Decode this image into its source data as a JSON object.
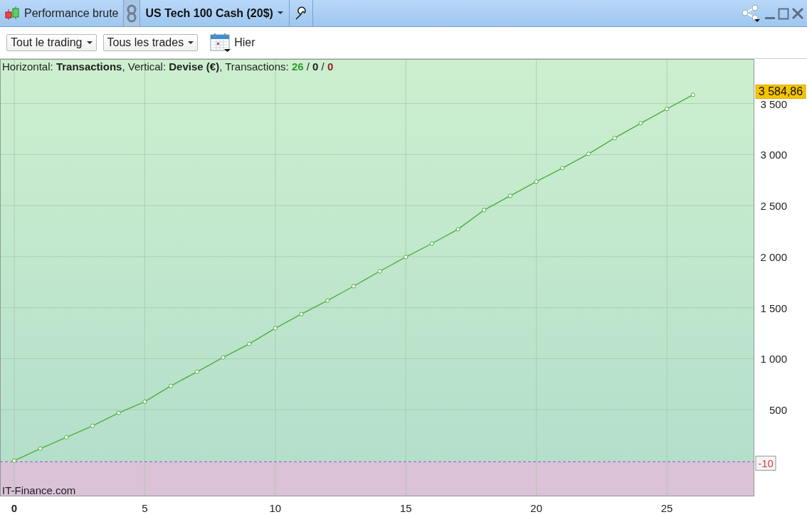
{
  "window": {
    "title": "Performance brute",
    "instrument": "US Tech 100 Cash (20$)"
  },
  "toolbar": {
    "dropdowns": [
      {
        "label": "Tout le trading"
      },
      {
        "label": "Tous les trades"
      }
    ],
    "date_label": "Hier"
  },
  "info_line": [
    {
      "text": "Horizontal: ",
      "kind": "plain"
    },
    {
      "text": "Transactions",
      "kind": "bold"
    },
    {
      "text": ", Vertical: ",
      "kind": "plain"
    },
    {
      "text": "Devise (€)",
      "kind": "bold"
    },
    {
      "text": ", Transactions: ",
      "kind": "plain"
    },
    {
      "text": "26",
      "kind": "bold",
      "color": "#2e9a2e"
    },
    {
      "text": " / ",
      "kind": "plain"
    },
    {
      "text": "0",
      "kind": "bold",
      "color": "#222222"
    },
    {
      "text": " / ",
      "kind": "plain"
    },
    {
      "text": "0",
      "kind": "bold",
      "color": "#a01c1c"
    }
  ],
  "chart": {
    "credit": "IT-Finance.com",
    "chart_data": {
      "type": "line",
      "x": [
        0,
        1,
        2,
        3,
        4,
        5,
        6,
        7,
        8,
        9,
        10,
        11,
        12,
        13,
        14,
        15,
        16,
        17,
        18,
        19,
        20,
        21,
        22,
        23,
        24,
        25,
        26
      ],
      "series": [
        {
          "color": "#4caf3c",
          "marker": "o",
          "values": [
            0,
            119,
            230,
            342,
            468,
            579,
            733,
            872,
            1012,
            1145,
            1298,
            1437,
            1570,
            1710,
            1856,
            1996,
            2128,
            2268,
            2456,
            2596,
            2735,
            2868,
            3007,
            3161,
            3307,
            3447,
            3585
          ]
        }
      ],
      "grid": true,
      "ref_lines": [
        {
          "axis": "y",
          "value": -10,
          "label": "-10",
          "color": "#9a6fc8"
        }
      ],
      "xlim": [
        -0.545,
        28.35
      ],
      "ylim": [
        -349,
        3936
      ],
      "xticks": [
        0,
        5,
        10,
        15,
        20,
        25
      ],
      "yticks": [
        {
          "value": 500,
          "label": "500"
        },
        {
          "value": 1000,
          "label": "1 000"
        },
        {
          "value": 1500,
          "label": "1 500"
        },
        {
          "value": 2000,
          "label": "2 000"
        },
        {
          "value": 2500,
          "label": "2 500"
        },
        {
          "value": 3000,
          "label": "3 000"
        },
        {
          "value": 3500,
          "label": "3 500"
        }
      ],
      "annotations": [
        "3 584,86"
      ]
    }
  }
}
